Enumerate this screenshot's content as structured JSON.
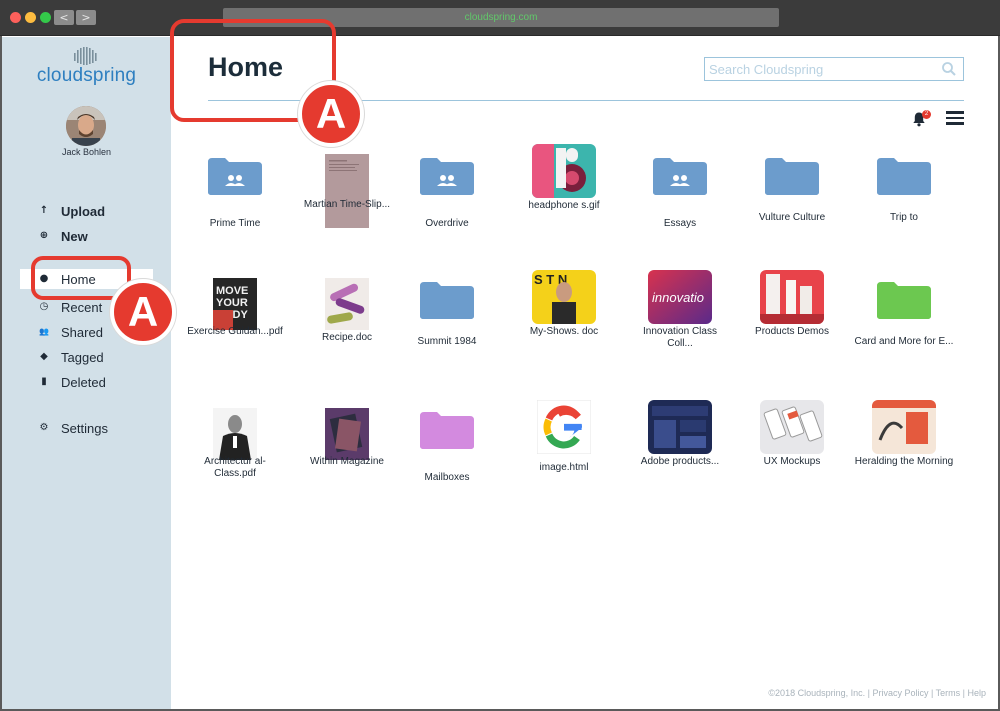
{
  "browser": {
    "url": "cloudspring.com",
    "back_glyph": "<",
    "forward_glyph": ">"
  },
  "sidebar": {
    "logo_text": "cloudspring",
    "user_name": "Jack Bohlen",
    "items": [
      {
        "label": "Upload",
        "icon": "arrow-up-icon",
        "glyph": "↑"
      },
      {
        "label": "New",
        "icon": "plus-circle-icon",
        "glyph": "⊕"
      },
      {
        "label": "Home",
        "icon": "home-icon",
        "glyph": "●"
      },
      {
        "label": "Recent",
        "icon": "clock-icon",
        "glyph": "◷"
      },
      {
        "label": "Shared",
        "icon": "people-icon",
        "glyph": "👥"
      },
      {
        "label": "Tagged",
        "icon": "tag-icon",
        "glyph": "◆"
      },
      {
        "label": "Deleted",
        "icon": "trash-icon",
        "glyph": "▮"
      },
      {
        "label": "Settings",
        "icon": "gear-icon",
        "glyph": "⚙"
      }
    ]
  },
  "header": {
    "title": "Home",
    "search_placeholder": "Search Cloudspring",
    "notification_count": "2"
  },
  "files": [
    {
      "label": "Prime Time",
      "kind": "shared-folder",
      "color": "#6c9ccc"
    },
    {
      "label": "Martian Time-Slip...",
      "kind": "document",
      "color": "#b39a9c"
    },
    {
      "label": "Overdrive",
      "kind": "shared-folder",
      "color": "#6c9ccc"
    },
    {
      "label": "headphone s.gif",
      "kind": "image",
      "color": "#c2345c"
    },
    {
      "label": "Essays",
      "kind": "shared-folder",
      "color": "#6c9ccc"
    },
    {
      "label": "Vulture Culture",
      "kind": "folder",
      "color": "#6c9ccc"
    },
    {
      "label": "Trip to",
      "kind": "folder",
      "color": "#6c9ccc"
    },
    {
      "label": "Exercise Guidan...pdf",
      "kind": "image",
      "color": "#2b2b2b"
    },
    {
      "label": "Recipe.doc",
      "kind": "image",
      "color": "#7d3c8c"
    },
    {
      "label": "Summit 1984",
      "kind": "folder",
      "color": "#6c9ccc"
    },
    {
      "label": "My-Shows. doc",
      "kind": "image",
      "color": "#f4d11a"
    },
    {
      "label": "Innovation Class Coll...",
      "kind": "image",
      "color": "#d8324e"
    },
    {
      "label": "Products Demos",
      "kind": "image",
      "color": "#e8434a"
    },
    {
      "label": "Card and More for E...",
      "kind": "folder",
      "color": "#6cc850"
    },
    {
      "label": "Architectur al-Class.pdf",
      "kind": "image",
      "color": "#444444"
    },
    {
      "label": "Within Magazine",
      "kind": "image",
      "color": "#5b3b6a"
    },
    {
      "label": "Mailboxes",
      "kind": "folder",
      "color": "#d28ade"
    },
    {
      "label": "image.html",
      "kind": "google",
      "color": "#ffffff"
    },
    {
      "label": "Adobe products...",
      "kind": "image",
      "color": "#1e2a55"
    },
    {
      "label": "UX Mockups",
      "kind": "image",
      "color": "#e7e7ea"
    },
    {
      "label": "Heralding the Morning",
      "kind": "image",
      "color": "#e45a3e"
    }
  ],
  "callouts": {
    "letter": "A"
  },
  "footer": "©2018 Cloudspring, Inc. | Privacy Policy | Terms | Help",
  "colors": {
    "sidebar_bg": "#d2e0e8",
    "accent": "#2e7fc0",
    "callout": "#e53a2f",
    "folder_blue": "#6c9ccc"
  }
}
